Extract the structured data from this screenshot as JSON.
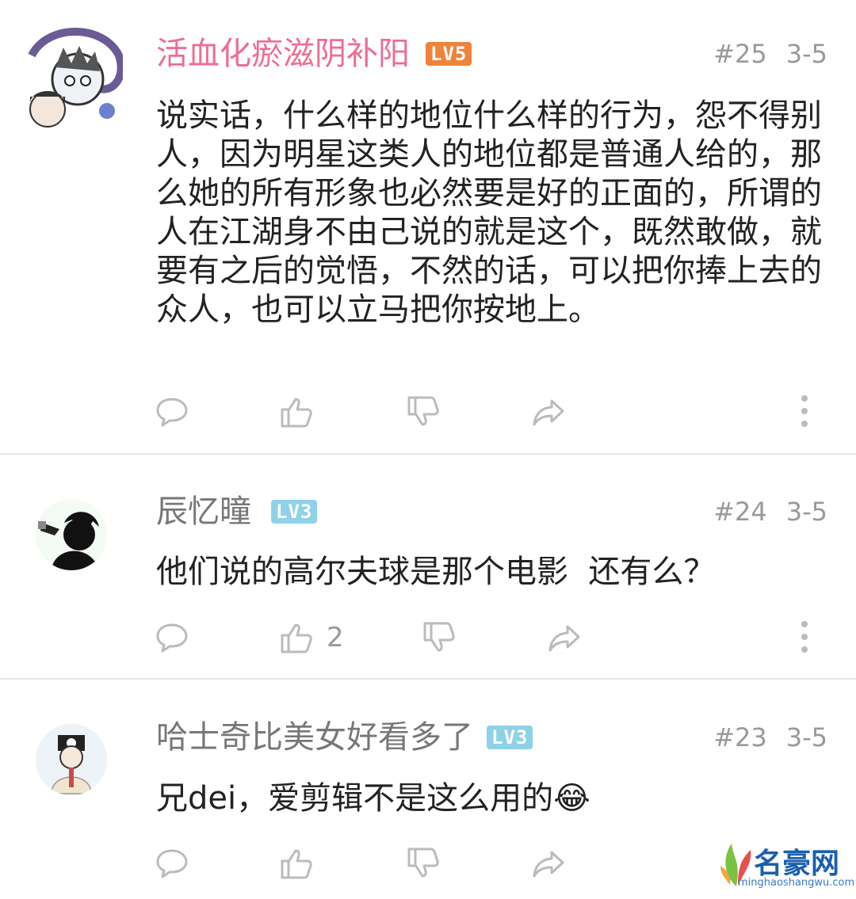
{
  "comments": [
    {
      "username": "活血化瘀滋阴补阳",
      "name_color": "#ee6d92",
      "level": "LV5",
      "level_color": "#f0833a",
      "floor": "#25",
      "date": "3-5",
      "text": "说实话，什么样的地位什么样的行为，怨不得别人，因为明星这类人的地位都是普通人给的，那么她的所有形象也必然要是好的正面的，所谓的人在江湖身不由己说的就是这个，既然敢做，就要有之后的觉悟，不然的话，可以把你捧上去的众人，也可以立马把你按地上。",
      "like_count": ""
    },
    {
      "username": "辰忆曈",
      "name_color": "#777777",
      "level": "LV3",
      "level_color": "#8fd1e8",
      "floor": "#24",
      "date": "3-5",
      "text": "他们说的高尔夫球是那个电影  还有么？",
      "like_count": "2"
    },
    {
      "username": "哈士奇比美女好看多了",
      "name_color": "#777777",
      "level": "LV3",
      "level_color": "#8fd1e8",
      "floor": "#23",
      "date": "3-5",
      "text": "兄dei，爱剪辑不是这么用的😂",
      "like_count": ""
    }
  ],
  "icons": {
    "reply": "comment-bubble-icon",
    "like": "thumb-up-icon",
    "dislike": "thumb-down-icon",
    "share": "share-arrow-icon",
    "more": "more-vertical-icon"
  },
  "watermark": {
    "title": "名豪网",
    "url": "minghaoshangwu.com"
  }
}
